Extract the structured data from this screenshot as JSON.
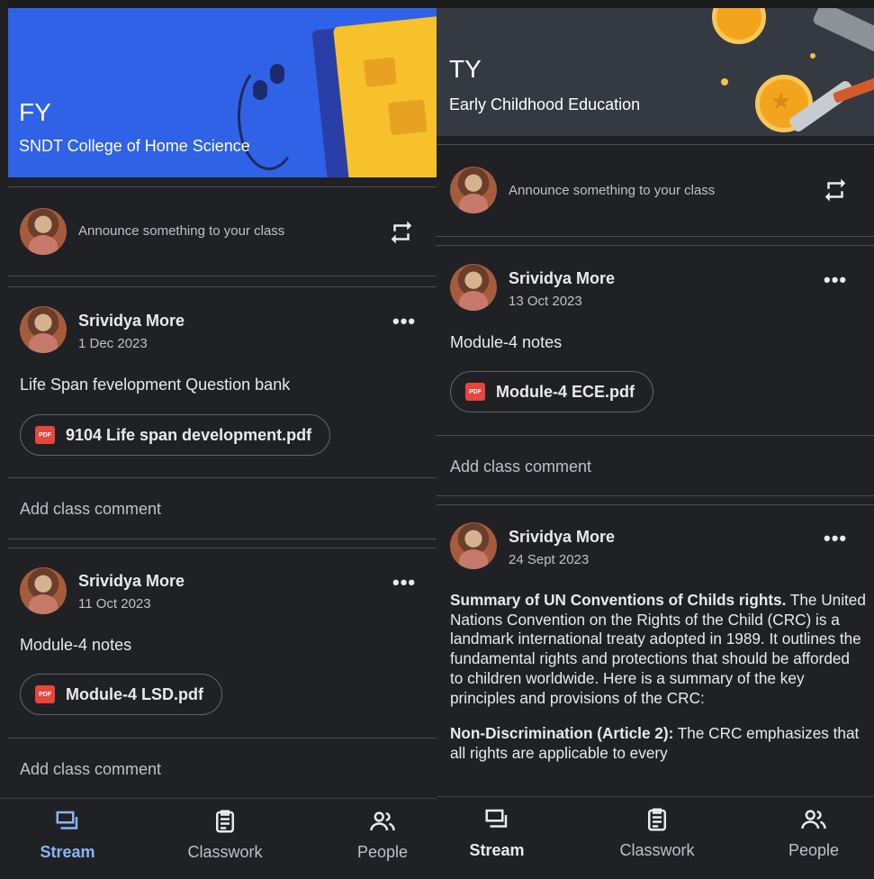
{
  "colors": {
    "background": "#202124",
    "accent_blue": "#8ab4f8",
    "left_banner": "#2f62e6",
    "right_banner": "#343942",
    "pdf_red": "#e8453c"
  },
  "left": {
    "banner": {
      "title": "FY",
      "subtitle": "SNDT College of Home Science"
    },
    "announce": {
      "placeholder": "Announce something to your class",
      "icon": "repost-icon"
    },
    "posts": [
      {
        "author": "Srividya More",
        "date": "1 Dec 2023",
        "text": "Life Span fevelopment Question bank",
        "attachment": "9104 Life span development.pdf",
        "comment": "Add class comment"
      },
      {
        "author": "Srividya More",
        "date": "11 Oct 2023",
        "text": "Module-4 notes",
        "attachment": "Module-4 LSD.pdf",
        "comment": "Add class comment"
      }
    ],
    "nav": {
      "stream": "Stream",
      "classwork": "Classwork",
      "people": "People",
      "active": "stream"
    }
  },
  "right": {
    "banner": {
      "title": "TY",
      "subtitle": "Early Childhood Education"
    },
    "announce": {
      "placeholder": "Announce something to your class",
      "icon": "repost-icon"
    },
    "posts": [
      {
        "author": "Srividya More",
        "date": "13 Oct 2023",
        "text": "Module-4 notes",
        "attachment": "Module-4 ECE.pdf",
        "comment": "Add class comment"
      },
      {
        "author": "Srividya More",
        "date": "24 Sept 2023",
        "heading": "Summary of UN Conventions of Childs rights.",
        "body": "The United Nations Convention on the Rights of the Child (CRC) is a landmark international treaty adopted in 1989. It outlines the fundamental rights and protections that should be afforded to children worldwide. Here is a summary of the key principles and provisions of the CRC:",
        "point_label": "Non-Discrimination (Article 2):",
        "point_text": "The CRC emphasizes that all rights are applicable to every"
      }
    ],
    "nav": {
      "stream": "Stream",
      "classwork": "Classwork",
      "people": "People",
      "active": "stream"
    }
  },
  "pdf_badge": "PDF"
}
